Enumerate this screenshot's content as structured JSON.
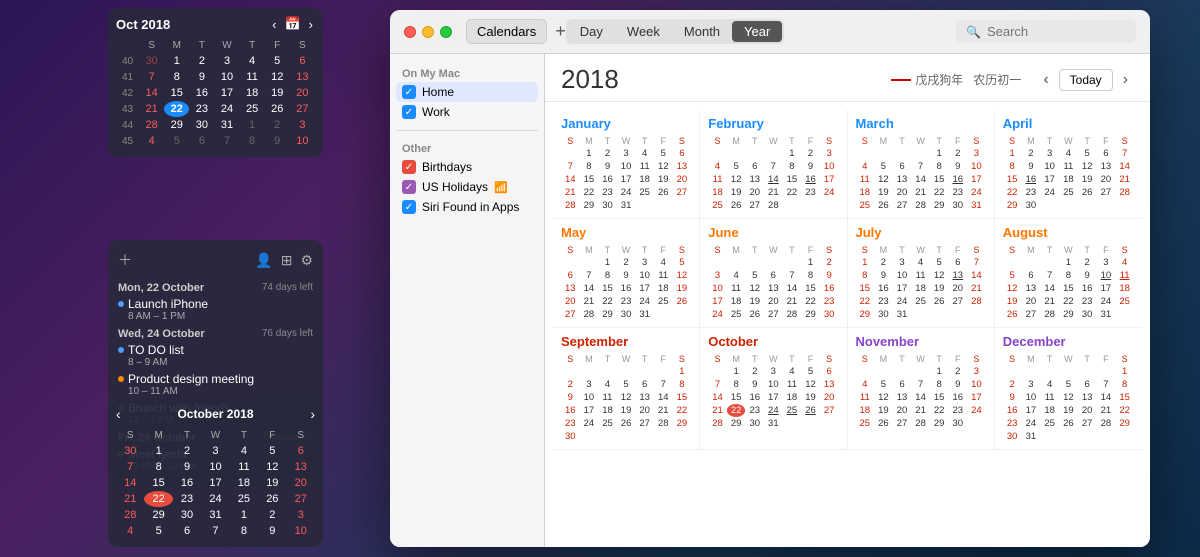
{
  "miniCal": {
    "title": "Oct 2018",
    "weekdays": [
      "S",
      "M",
      "T",
      "W",
      "T",
      "F",
      "S"
    ],
    "weeks": [
      {
        "num": "40",
        "days": [
          {
            "d": "30",
            "cls": "other-month sun-other"
          },
          {
            "d": "1",
            "cls": ""
          },
          {
            "d": "2",
            "cls": ""
          },
          {
            "d": "3",
            "cls": ""
          },
          {
            "d": "4",
            "cls": ""
          },
          {
            "d": "5",
            "cls": ""
          },
          {
            "d": "6",
            "cls": "weekend"
          }
        ]
      },
      {
        "num": "41",
        "days": [
          {
            "d": "7",
            "cls": "weekend"
          },
          {
            "d": "8",
            "cls": ""
          },
          {
            "d": "9",
            "cls": ""
          },
          {
            "d": "10",
            "cls": ""
          },
          {
            "d": "11",
            "cls": ""
          },
          {
            "d": "12",
            "cls": ""
          },
          {
            "d": "13",
            "cls": "weekend"
          }
        ]
      },
      {
        "num": "42",
        "days": [
          {
            "d": "14",
            "cls": "weekend"
          },
          {
            "d": "15",
            "cls": ""
          },
          {
            "d": "16",
            "cls": ""
          },
          {
            "d": "17",
            "cls": ""
          },
          {
            "d": "18",
            "cls": ""
          },
          {
            "d": "19",
            "cls": ""
          },
          {
            "d": "20",
            "cls": "weekend"
          }
        ]
      },
      {
        "num": "43",
        "days": [
          {
            "d": "21",
            "cls": "weekend"
          },
          {
            "d": "22",
            "cls": "today"
          },
          {
            "d": "23",
            "cls": ""
          },
          {
            "d": "24",
            "cls": ""
          },
          {
            "d": "25",
            "cls": ""
          },
          {
            "d": "26",
            "cls": ""
          },
          {
            "d": "27",
            "cls": "weekend"
          }
        ]
      },
      {
        "num": "44",
        "days": [
          {
            "d": "28",
            "cls": "weekend"
          },
          {
            "d": "29",
            "cls": ""
          },
          {
            "d": "30",
            "cls": ""
          },
          {
            "d": "31",
            "cls": ""
          },
          {
            "d": "1",
            "cls": "other-month"
          },
          {
            "d": "2",
            "cls": "other-month"
          },
          {
            "d": "3",
            "cls": "other-month weekend"
          }
        ]
      },
      {
        "num": "45",
        "days": [
          {
            "d": "4",
            "cls": "other-month weekend"
          },
          {
            "d": "5",
            "cls": "other-month"
          },
          {
            "d": "6",
            "cls": "other-month"
          },
          {
            "d": "7",
            "cls": "other-month"
          },
          {
            "d": "8",
            "cls": "other-month"
          },
          {
            "d": "9",
            "cls": "other-month"
          },
          {
            "d": "10",
            "cls": "other-month weekend"
          }
        ]
      }
    ]
  },
  "eventPanel": {
    "monHeader": "Mon, 22 October",
    "monDaysLeft": "74 days left",
    "wedHeader": "Wed, 24 October",
    "wedDaysLeft": "76 days left",
    "friHeader": "Fri, 26 October",
    "friDaysLeft": "78 days left",
    "events": [
      {
        "title": "Launch iPhone",
        "time": "8 AM – 1 PM",
        "color": "blue",
        "day": "mon"
      },
      {
        "title": "TO DO list",
        "time": "8 – 9 AM",
        "color": "blue",
        "day": "wed"
      },
      {
        "title": "Product design meeting",
        "time": "10 – 11 AM",
        "color": "orange",
        "day": "wed"
      },
      {
        "title": "Brunch with friends",
        "time": "12 – 1 PM",
        "color": "blue",
        "day": "wed"
      },
      {
        "title": "Meet lynda",
        "time": "11 AM – 12 PM",
        "color": "green",
        "day": "fri"
      }
    ]
  },
  "app": {
    "titlebar": {
      "calendarsBtn": "Calendars",
      "addBtn": "+",
      "tabs": [
        "Day",
        "Week",
        "Month",
        "Year"
      ],
      "activeTab": "Year",
      "searchPlaceholder": "Search"
    },
    "sidebar": {
      "onMyMacLabel": "On My Mac",
      "otherLabel": "Other",
      "items": [
        {
          "label": "Home",
          "color": "blue",
          "checked": true
        },
        {
          "label": "Work",
          "color": "blue",
          "checked": true
        },
        {
          "label": "Birthdays",
          "color": "red",
          "checked": true
        },
        {
          "label": "US Holidays",
          "color": "purple",
          "checked": true
        },
        {
          "label": "Siri Found in Apps",
          "color": "blue",
          "checked": true
        }
      ]
    },
    "yearView": {
      "year": "2018",
      "chineseZodiac": "戊戌狗年",
      "chineseCal": "农历初一",
      "todayBtn": "Today",
      "months": [
        {
          "name": "January",
          "nameClass": "blue",
          "headers": [
            "S",
            "M",
            "T",
            "W",
            "T",
            "F",
            "S"
          ],
          "rows": [
            [
              "",
              "1",
              "2",
              "3",
              "4",
              "5",
              "6"
            ],
            [
              "7",
              "8",
              "9",
              "10",
              "11",
              "12",
              "13"
            ],
            [
              "14",
              "15",
              "16",
              "17",
              "18",
              "19",
              "20"
            ],
            [
              "21",
              "22",
              "23",
              "24",
              "25",
              "26",
              "27"
            ],
            [
              "28",
              "29",
              "30",
              "31",
              "",
              "",
              ""
            ]
          ]
        },
        {
          "name": "February",
          "nameClass": "blue",
          "headers": [
            "S",
            "M",
            "T",
            "W",
            "T",
            "F",
            "S"
          ],
          "rows": [
            [
              "",
              "",
              "",
              "",
              "1",
              "2",
              "3"
            ],
            [
              "4",
              "5",
              "6",
              "7",
              "8",
              "9",
              "10"
            ],
            [
              "11",
              "12",
              "13",
              "14",
              "15",
              "16",
              "17"
            ],
            [
              "18",
              "19",
              "20",
              "21",
              "22",
              "23",
              "24"
            ],
            [
              "25",
              "26",
              "27",
              "28",
              "",
              "",
              ""
            ]
          ]
        },
        {
          "name": "March",
          "nameClass": "blue",
          "headers": [
            "S",
            "M",
            "T",
            "W",
            "T",
            "F",
            "S"
          ],
          "rows": [
            [
              "",
              "",
              "",
              "",
              "1",
              "2",
              "3"
            ],
            [
              "4",
              "5",
              "6",
              "7",
              "8",
              "9",
              "10"
            ],
            [
              "11",
              "12",
              "13",
              "14",
              "15",
              "16",
              "17"
            ],
            [
              "18",
              "19",
              "20",
              "21",
              "22",
              "23",
              "24"
            ],
            [
              "25",
              "26",
              "27",
              "28",
              "29",
              "30",
              "31"
            ]
          ]
        },
        {
          "name": "April",
          "nameClass": "blue",
          "headers": [
            "S",
            "M",
            "T",
            "W",
            "T",
            "F",
            "S"
          ],
          "rows": [
            [
              "1",
              "2",
              "3",
              "4",
              "5",
              "6",
              "7"
            ],
            [
              "8",
              "9",
              "10",
              "11",
              "12",
              "13",
              "14"
            ],
            [
              "15",
              "16",
              "17",
              "18",
              "19",
              "20",
              "21"
            ],
            [
              "22",
              "23",
              "24",
              "25",
              "26",
              "27",
              "28"
            ],
            [
              "29",
              "30",
              "",
              "",
              "",
              "",
              ""
            ]
          ]
        },
        {
          "name": "May",
          "nameClass": "orange",
          "headers": [
            "S",
            "M",
            "T",
            "W",
            "T",
            "F",
            "S"
          ],
          "rows": [
            [
              "",
              "",
              "1",
              "2",
              "3",
              "4",
              "5"
            ],
            [
              "6",
              "7",
              "8",
              "9",
              "10",
              "11",
              "12"
            ],
            [
              "13",
              "14",
              "15",
              "16",
              "17",
              "18",
              "19"
            ],
            [
              "20",
              "21",
              "22",
              "23",
              "24",
              "25",
              "26"
            ],
            [
              "27",
              "28",
              "29",
              "30",
              "31",
              "",
              ""
            ]
          ]
        },
        {
          "name": "June",
          "nameClass": "orange",
          "headers": [
            "S",
            "M",
            "T",
            "W",
            "T",
            "F",
            "S"
          ],
          "rows": [
            [
              "",
              "",
              "",
              "",
              "",
              "1",
              "2"
            ],
            [
              "3",
              "4",
              "5",
              "6",
              "7",
              "8",
              "9"
            ],
            [
              "10",
              "11",
              "12",
              "13",
              "14",
              "15",
              "16"
            ],
            [
              "17",
              "18",
              "19",
              "20",
              "21",
              "22",
              "23"
            ],
            [
              "24",
              "25",
              "26",
              "27",
              "28",
              "29",
              "30"
            ]
          ]
        },
        {
          "name": "July",
          "nameClass": "orange",
          "headers": [
            "S",
            "M",
            "T",
            "W",
            "T",
            "F",
            "S"
          ],
          "rows": [
            [
              "1",
              "2",
              "3",
              "4",
              "5",
              "6",
              "7"
            ],
            [
              "8",
              "9",
              "10",
              "11",
              "12",
              "13",
              "14"
            ],
            [
              "15",
              "16",
              "17",
              "18",
              "19",
              "20",
              "21"
            ],
            [
              "22",
              "23",
              "24",
              "25",
              "26",
              "27",
              "28"
            ],
            [
              "29",
              "30",
              "31",
              "",
              "",
              "",
              ""
            ]
          ]
        },
        {
          "name": "August",
          "nameClass": "orange",
          "headers": [
            "S",
            "M",
            "T",
            "W",
            "T",
            "F",
            "S"
          ],
          "rows": [
            [
              "",
              "",
              "",
              "1",
              "2",
              "3",
              "4"
            ],
            [
              "5",
              "6",
              "7",
              "8",
              "9",
              "10",
              "11"
            ],
            [
              "12",
              "13",
              "14",
              "15",
              "16",
              "17",
              "18"
            ],
            [
              "19",
              "20",
              "21",
              "22",
              "23",
              "24",
              "25"
            ],
            [
              "26",
              "27",
              "28",
              "29",
              "30",
              "31",
              ""
            ]
          ]
        },
        {
          "name": "September",
          "nameClass": "red",
          "headers": [
            "S",
            "M",
            "T",
            "W",
            "T",
            "F",
            "S"
          ],
          "rows": [
            [
              "",
              "",
              "",
              "",
              "",
              "",
              "1"
            ],
            [
              "2",
              "3",
              "4",
              "5",
              "6",
              "7",
              "8"
            ],
            [
              "9",
              "10",
              "11",
              "12",
              "13",
              "14",
              "15"
            ],
            [
              "16",
              "17",
              "18",
              "19",
              "20",
              "21",
              "22"
            ],
            [
              "23",
              "24",
              "25",
              "26",
              "27",
              "28",
              "29"
            ],
            [
              "30",
              "",
              "",
              "",
              "",
              "",
              ""
            ]
          ]
        },
        {
          "name": "October",
          "nameClass": "red",
          "headers": [
            "S",
            "M",
            "T",
            "W",
            "T",
            "F",
            "S"
          ],
          "rows": [
            [
              "",
              "1",
              "2",
              "3",
              "4",
              "5",
              "6"
            ],
            [
              "7",
              "8",
              "9",
              "10",
              "11",
              "12",
              "13"
            ],
            [
              "14",
              "15",
              "16",
              "17",
              "18",
              "19",
              "20"
            ],
            [
              "21",
              "22",
              "23",
              "24",
              "25",
              "26",
              "27"
            ],
            [
              "28",
              "29",
              "30",
              "31",
              "",
              "",
              ""
            ]
          ],
          "todayDate": "22",
          "highlight": "22"
        },
        {
          "name": "November",
          "nameClass": "purple",
          "headers": [
            "S",
            "M",
            "T",
            "W",
            "T",
            "F",
            "S"
          ],
          "rows": [
            [
              "",
              "",
              "",
              "",
              "1",
              "2",
              "3"
            ],
            [
              "4",
              "5",
              "6",
              "7",
              "8",
              "9",
              "10"
            ],
            [
              "11",
              "12",
              "13",
              "14",
              "15",
              "16",
              "17"
            ],
            [
              "18",
              "19",
              "20",
              "21",
              "22",
              "23",
              "24"
            ],
            [
              "25",
              "26",
              "27",
              "28",
              "29",
              "30",
              ""
            ]
          ]
        },
        {
          "name": "December",
          "nameClass": "purple",
          "headers": [
            "S",
            "M",
            "T",
            "W",
            "T",
            "F",
            "S"
          ],
          "rows": [
            [
              "",
              "",
              "",
              "",
              "",
              "",
              "1"
            ],
            [
              "2",
              "3",
              "4",
              "5",
              "6",
              "7",
              "8"
            ],
            [
              "9",
              "10",
              "11",
              "12",
              "13",
              "14",
              "15"
            ],
            [
              "16",
              "17",
              "18",
              "19",
              "20",
              "21",
              "22"
            ],
            [
              "23",
              "24",
              "25",
              "26",
              "27",
              "28",
              "29"
            ],
            [
              "30",
              "31",
              "",
              "",
              "",
              "",
              ""
            ]
          ]
        }
      ]
    }
  },
  "bottomMiniCal": {
    "title": "October 2018",
    "weekdays": [
      "S",
      "M",
      "T",
      "W",
      "T",
      "F",
      "S"
    ],
    "rows": [
      [
        "30",
        "1",
        "2",
        "3",
        "4",
        "5",
        "6"
      ],
      [
        "7",
        "8",
        "9",
        "10",
        "11",
        "12",
        "13"
      ],
      [
        "14",
        "15",
        "16",
        "17",
        "18",
        "19",
        "20"
      ],
      [
        "21",
        "22",
        "23",
        "24",
        "25",
        "26",
        "27"
      ],
      [
        "28",
        "29",
        "30",
        "31",
        "1",
        "2",
        "3"
      ],
      [
        "4",
        "5",
        "6",
        "7",
        "8",
        "9",
        "10"
      ]
    ]
  }
}
